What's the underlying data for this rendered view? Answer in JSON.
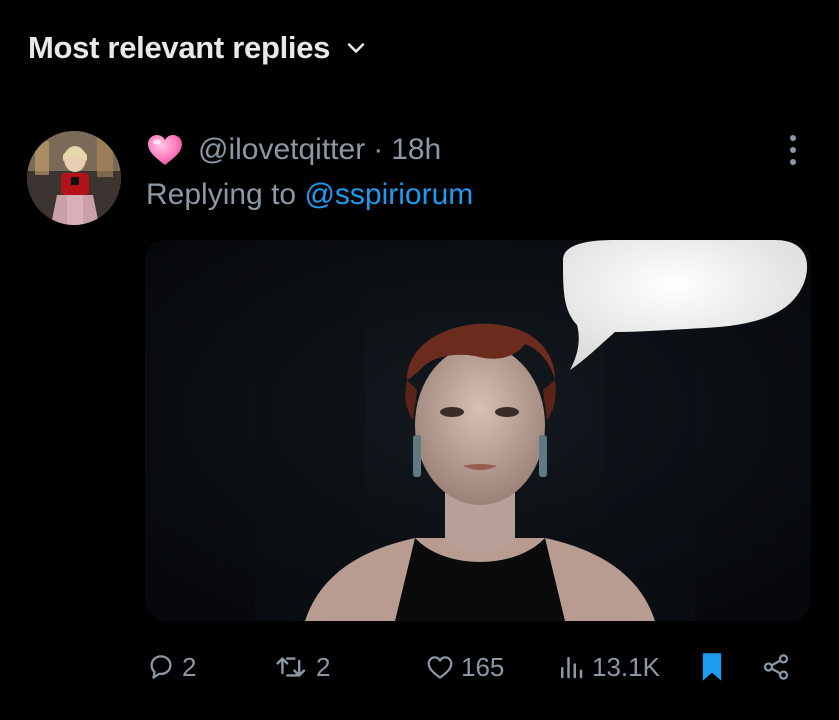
{
  "header": {
    "sort_label": "Most relevant replies",
    "chevron_icon": "chevron-down-icon"
  },
  "reply": {
    "emoji": "pink-heart",
    "handle": "@ilovetqitter",
    "separator": "·",
    "time": "18h",
    "replying_prefix": "Replying to ",
    "replying_to": "@sspiriorum",
    "more_icon": "more-vertical-icon",
    "media_icon": "photo"
  },
  "actions": {
    "replies": "2",
    "reposts": "2",
    "likes": "165",
    "views": "13.1K",
    "bookmarked": true,
    "share_icon": "share-icon"
  },
  "colors": {
    "background": "#000000",
    "text_primary": "#e7e9ea",
    "text_secondary": "#8b98a5",
    "accent": "#1d9bf0",
    "heart_pink": "#ff7fbf"
  }
}
